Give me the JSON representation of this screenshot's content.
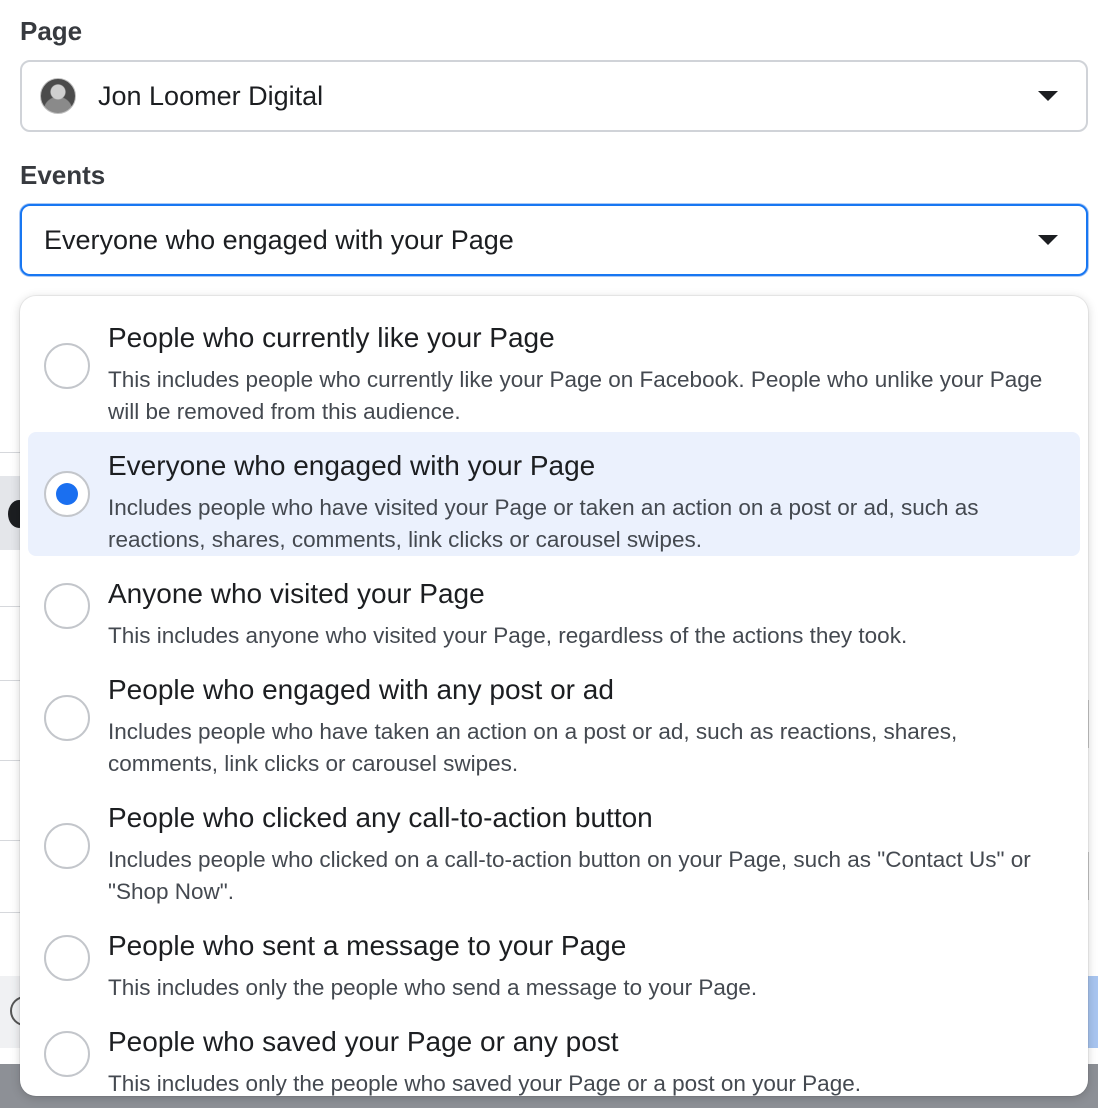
{
  "page_field": {
    "label": "Page",
    "value": "Jon Loomer Digital"
  },
  "events_field": {
    "label": "Events",
    "value": "Everyone who engaged with your Page"
  },
  "options": [
    {
      "title": "People who currently like your Page",
      "description": "This includes people who currently like your Page on Facebook. People who unlike your Page will be removed from this audience.",
      "selected": false
    },
    {
      "title": "Everyone who engaged with your Page",
      "description": "Includes people who have visited your Page or taken an action on a post or ad, such as reactions, shares, comments, link clicks or carousel swipes.",
      "selected": true
    },
    {
      "title": "Anyone who visited your Page",
      "description": "This includes anyone who visited your Page, regardless of the actions they took.",
      "selected": false
    },
    {
      "title": "People who engaged with any post or ad",
      "description": "Includes people who have taken an action on a post or ad, such as reactions, shares, comments, link clicks or carousel swipes.",
      "selected": false
    },
    {
      "title": "People who clicked any call-to-action button",
      "description": "Includes people who clicked on a call-to-action button on your Page, such as \"Contact Us\" or \"Shop Now\".",
      "selected": false
    },
    {
      "title": "People who sent a message to your Page",
      "description": "This includes only the people who send a message to your Page.",
      "selected": false
    },
    {
      "title": "People who saved your Page or any post",
      "description": "This includes only the people who saved your Page or a post on your Page.",
      "selected": false
    }
  ],
  "colors": {
    "accent": "#1877f2",
    "selected_bg": "#ebf1fd",
    "radio_dot": "#1a6ff0"
  }
}
